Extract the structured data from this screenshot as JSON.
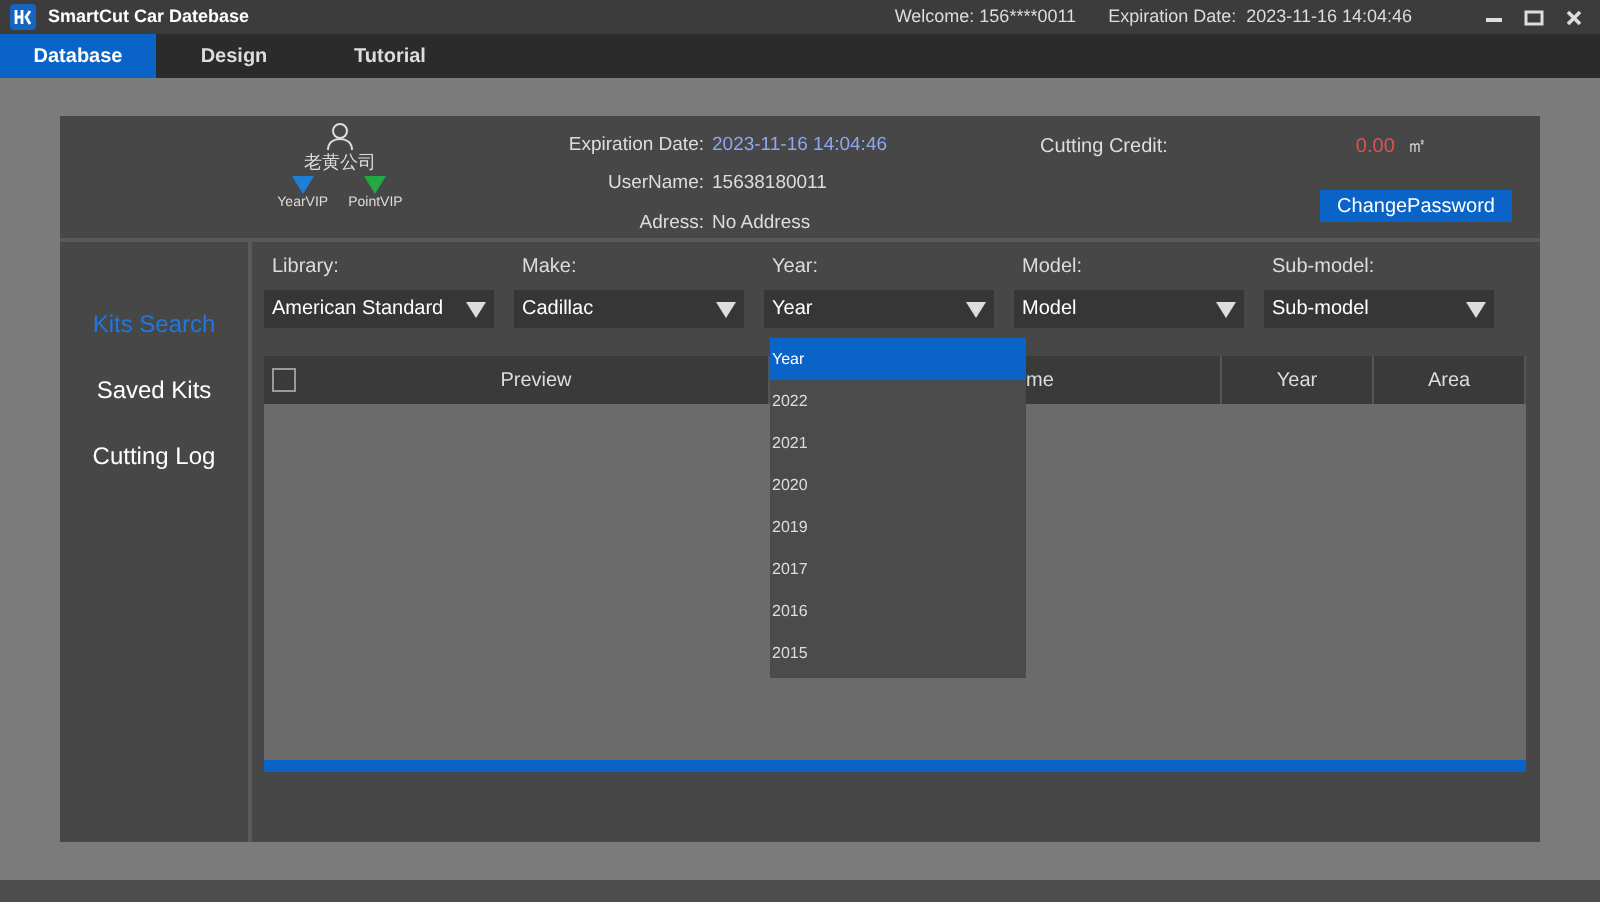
{
  "window": {
    "title": "SmartCut Car Datebase",
    "welcome": "Welcome: 156****0011",
    "expiration": "Expiration Date:  2023-11-16 14:04:46"
  },
  "tabs": [
    {
      "label": "Database",
      "selected": true
    },
    {
      "label": "Design",
      "selected": false
    },
    {
      "label": "Tutorial",
      "selected": false
    }
  ],
  "account": {
    "company": "老黄公司",
    "badges": [
      {
        "label": "YearVIP",
        "color": "#1e7fd6"
      },
      {
        "label": "PointVIP",
        "color": "#22a845"
      }
    ],
    "fields": [
      {
        "label": "Expiration Date:",
        "value": "2023-11-16 14:04:46",
        "kind": "highlight"
      },
      {
        "label": "UserName:",
        "value": "15638180011",
        "kind": "plain"
      },
      {
        "label": "Adress:",
        "value": "No Address",
        "kind": "plain"
      }
    ],
    "credit_label": "Cutting Credit:",
    "credit_value": "0.00",
    "credit_unit": "㎡",
    "button": "ChangePassword"
  },
  "sidebar": {
    "items": [
      {
        "label": "Kits Search",
        "selected": true
      },
      {
        "label": "Saved Kits",
        "selected": false
      },
      {
        "label": "Cutting Log",
        "selected": false
      }
    ]
  },
  "filters": [
    {
      "label": "Library:",
      "value": "American Standard"
    },
    {
      "label": "Make:",
      "value": "Cadillac"
    },
    {
      "label": "Year:",
      "value": "Year",
      "open": true
    },
    {
      "label": "Model:",
      "value": "Model"
    },
    {
      "label": "Sub-model:",
      "value": "Sub-model"
    }
  ],
  "dropdown": {
    "options": [
      {
        "label": "Year",
        "selected": true
      },
      {
        "label": "2022",
        "selected": false
      },
      {
        "label": "2021",
        "selected": false
      },
      {
        "label": "2020",
        "selected": false
      },
      {
        "label": "2019",
        "selected": false
      },
      {
        "label": "2017",
        "selected": false
      },
      {
        "label": "2016",
        "selected": false
      },
      {
        "label": "2015",
        "selected": false
      }
    ]
  },
  "table": {
    "select_all_checked": false,
    "columns": [
      "Preview",
      "me",
      "Year",
      "Area"
    ]
  }
}
